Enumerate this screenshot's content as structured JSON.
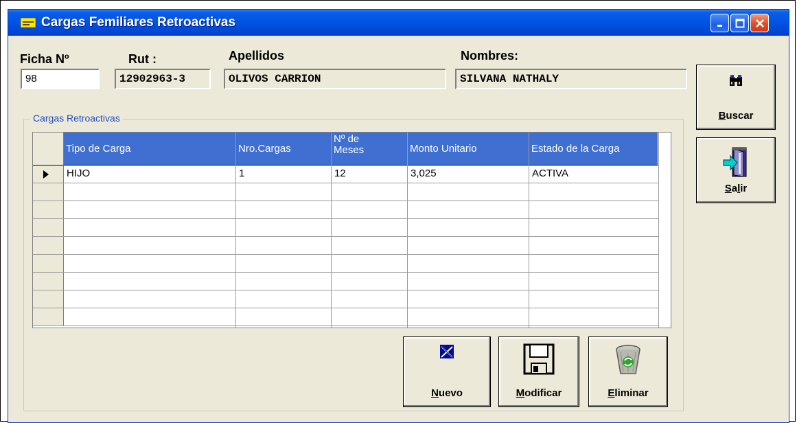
{
  "window": {
    "title": "Cargas Femiliares Retroactivas",
    "controls": [
      "minimize-icon",
      "maximize-icon",
      "close-icon"
    ]
  },
  "header_fields": {
    "ficha_label": "Ficha Nº",
    "ficha_value": "98",
    "rut_label": "Rut :",
    "rut_value": "12902963-3",
    "apellidos_label": "Apellidos",
    "apellidos_value": "OLIVOS CARRION",
    "nombres_label": "Nombres:",
    "nombres_value": "SILVANA NATHALY"
  },
  "group": {
    "title": "Cargas Retroactivas"
  },
  "grid": {
    "columns": [
      "Tipo de Carga",
      "Nro.Cargas",
      "Nº de\nMeses",
      "Monto Unitario",
      "Estado de la Carga"
    ],
    "rows": [
      {
        "tipo": "HIJO",
        "nro": "1",
        "meses": "12",
        "monto": "3,025",
        "estado": "ACTIVA",
        "current": true
      }
    ],
    "empty_rows": 8,
    "current_row_indicator": "triangle-right-icon"
  },
  "buttons": {
    "buscar": {
      "label_first": "B",
      "label_rest": "uscar",
      "icon": "binoculars-icon"
    },
    "salir": {
      "label_first": "S",
      "label_mid": "a",
      "label_u2": "l",
      "label_rest": "ir",
      "icon": "exit-door-icon"
    },
    "nuevo": {
      "label_first": "N",
      "label_rest": "uevo",
      "icon": "new-record-icon"
    },
    "modificar": {
      "label_first": "M",
      "label_rest": "odificar",
      "icon": "floppy-disk-icon"
    },
    "eliminar": {
      "label_first": "E",
      "label_rest": "liminar",
      "icon": "recycle-bin-icon"
    }
  },
  "colors": {
    "titlebar": "#0055E5",
    "window_bg": "#ECE9D8",
    "grid_header": "#3F6FD1",
    "group_title": "#1F4EC9"
  }
}
